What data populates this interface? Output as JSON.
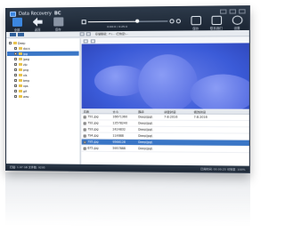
{
  "app": {
    "title": "Data Recovery",
    "brand": "BC"
  },
  "toolbar": {
    "buttons": [
      {
        "label": "全部",
        "icon": "drive-icon",
        "color": "#3c87e0"
      },
      {
        "label": "返回",
        "icon": "back-icon",
        "color": "#e8eef7"
      },
      {
        "label": "保存",
        "icon": "save-icon",
        "color": "#8a95a5"
      }
    ],
    "right_buttons": [
      {
        "label": "保存",
        "icon": "save-icon"
      },
      {
        "label": "联系我们",
        "icon": "mail-icon"
      },
      {
        "label": "设置",
        "icon": "gear-icon"
      }
    ]
  },
  "player": {
    "time": "0:00:0 / 0:25:0",
    "progress": 0.62
  },
  "address": {
    "path": "存储路径：F:\\... \\已恢复\\..."
  },
  "tree": {
    "items": [
      {
        "label": "Deep",
        "indent": 0,
        "selected": false
      },
      {
        "label": "docx",
        "indent": 6,
        "selected": false
      },
      {
        "label": "jpg",
        "indent": 6,
        "selected": true
      },
      {
        "label": "jpeg",
        "indent": 6,
        "selected": false
      },
      {
        "label": "zip",
        "indent": 6,
        "selected": false
      },
      {
        "label": "png",
        "indent": 6,
        "selected": false
      },
      {
        "label": "xls",
        "indent": 6,
        "selected": false
      },
      {
        "label": "bmp",
        "indent": 6,
        "selected": false
      },
      {
        "label": "xps",
        "indent": 6,
        "selected": false
      },
      {
        "label": "gif",
        "indent": 6,
        "selected": false
      },
      {
        "label": "wav",
        "indent": 6,
        "selected": false
      }
    ]
  },
  "table": {
    "headers": [
      "名称",
      "大小",
      "路径",
      "创建时间",
      "修改时间"
    ],
    "rows": [
      {
        "name": "791.jpg",
        "size": "16671360",
        "path": "Deep\\jpg\\",
        "created": "7-8-2016",
        "modified": "7-8-2016",
        "selected": false
      },
      {
        "name": "792.jpg",
        "size": "13578240",
        "path": "Deep\\jpg\\",
        "created": "",
        "modified": "",
        "selected": false
      },
      {
        "name": "793.jpg",
        "size": "2424832",
        "path": "Deep\\jpg\\",
        "created": "",
        "modified": "",
        "selected": false
      },
      {
        "name": "794.jpg",
        "size": "114688",
        "path": "Deep\\jpg\\",
        "created": "",
        "modified": "",
        "selected": false
      },
      {
        "name": "795.jpg",
        "size": "9568128",
        "path": "Deep\\jpg\\",
        "created": "",
        "modified": "",
        "selected": true
      },
      {
        "name": "675.jpg",
        "size": "5957888",
        "path": "Deep\\jpg\\",
        "created": "",
        "modified": "",
        "selected": false
      }
    ]
  },
  "status": {
    "left": "扫描: 1.97 GB   文件数: 9295",
    "right": "已用时间: 00:00:25   可恢复: 100%"
  },
  "colors": {
    "accent": "#3a76c6",
    "toolbar": "#1b2533",
    "preview": "#3b5bd8"
  }
}
